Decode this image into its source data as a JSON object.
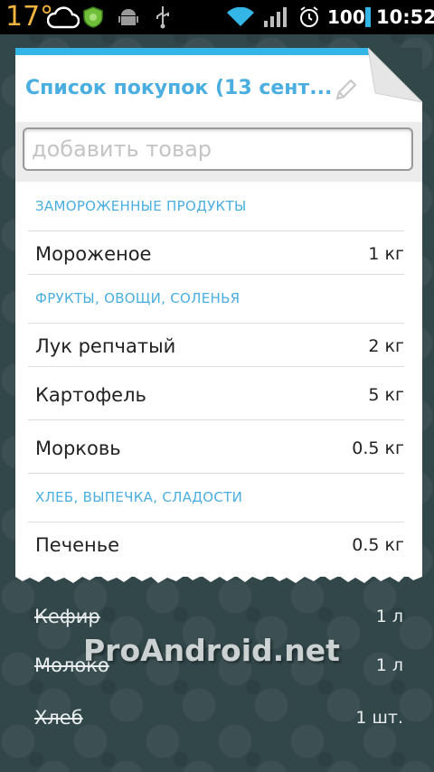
{
  "status_bar": {
    "temperature": "17°",
    "battery": "100",
    "time": "10:52",
    "icons": [
      "weather-cloud-icon",
      "shield-icon",
      "android-debug-icon",
      "usb-icon",
      "wifi-icon",
      "signal-icon",
      "alarm-icon"
    ]
  },
  "header": {
    "title": "Список покупок (13 сент...",
    "edit_icon": "pencil-icon"
  },
  "input": {
    "placeholder": "добавить товар"
  },
  "sections": [
    {
      "title": "ЗАМОРОЖЕННЫЕ ПРОДУКТЫ",
      "items": [
        {
          "name": "Мороженое",
          "qty": "1 кг"
        }
      ]
    },
    {
      "title": "ФРУКТЫ, ОВОЩИ, СОЛЕНЬЯ",
      "items": [
        {
          "name": "Лук репчатый",
          "qty": "2 кг"
        },
        {
          "name": "Картофель",
          "qty": "5 кг"
        },
        {
          "name": "Морковь",
          "qty": "0.5 кг"
        }
      ]
    },
    {
      "title": "ХЛЕБ, ВЫПЕЧКА, СЛАДОСТИ",
      "items": [
        {
          "name": "Печенье",
          "qty": "0.5 кг"
        }
      ]
    }
  ],
  "done_items": [
    {
      "name": "Кефир",
      "qty": "1 л"
    },
    {
      "name": "Молоко",
      "qty": "1 л"
    },
    {
      "name": "Хлеб",
      "qty": "1 шт."
    }
  ],
  "watermark": "ProAndroid.net",
  "colors": {
    "accent": "#33b5e5",
    "section_text": "#4aaee0",
    "background": "#31474a"
  }
}
